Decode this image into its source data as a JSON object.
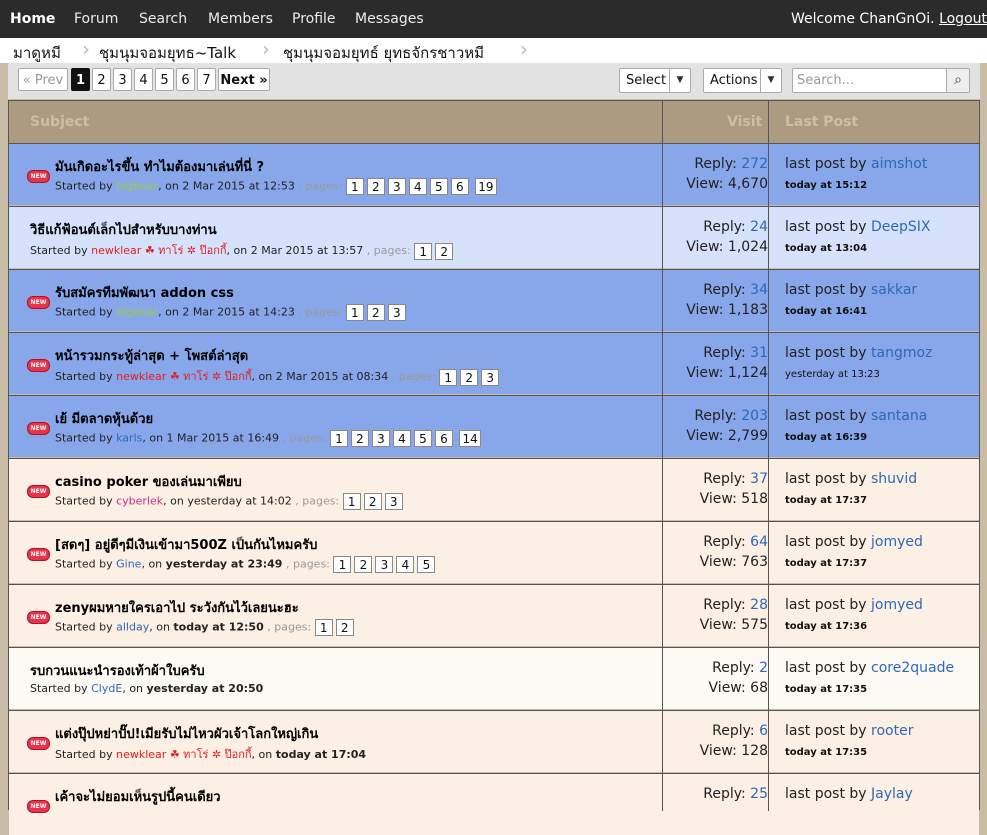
{
  "nav": {
    "items": [
      "Home",
      "Forum",
      "Search",
      "Members",
      "Profile",
      "Messages"
    ],
    "welcome": "Welcome ChanGnOi.",
    "logout": "Logout"
  },
  "breadcrumb": [
    "มาดูหมี",
    "ชุมนุมจอมยุทธ~Talk",
    "ชุมนุมจอมยุทธ์ ยุทธจักรชาวหมี"
  ],
  "pagination": {
    "prev": "« Prev",
    "pages": [
      "1",
      "2",
      "3",
      "4",
      "5",
      "6",
      "7"
    ],
    "current": "1",
    "next": "Next »"
  },
  "controls": {
    "select_label": "Select",
    "actions_label": "Actions",
    "search_placeholder": "Search..."
  },
  "table": {
    "headers": {
      "subject": "Subject",
      "visit": "Visit",
      "last_post": "Last Post"
    },
    "reply_label": "Reply:",
    "view_label": "View:",
    "last_post_by_label": "last post by",
    "started_by_label": "Started by",
    "pages_label": "pages:",
    "rows": [
      {
        "title": "มันเกิดอะไรขึ้น ทำไมต้องมาเล่นที่นี่ ?",
        "author": "bigbear",
        "date": "on 2 Mar 2015 at 12:53",
        "pages": [
          "1",
          "2",
          "3",
          "4",
          "5",
          "6",
          "19"
        ],
        "replies": "272",
        "views": "4,670",
        "last_user": "aimshot",
        "last_time": "today at 15:12"
      },
      {
        "title": "วิธีแก้ฟ้อนต์เล็กไปสำหรับบางท่าน",
        "author": "newklear ☘ ทาโร่ ✲ ป๊อกกี้",
        "date": "on 2 Mar 2015 at 13:57",
        "pages": [
          "1",
          "2"
        ],
        "replies": "24",
        "views": "1,024",
        "last_user": "DeepSIX",
        "last_time": "today at 13:04"
      },
      {
        "title": "รับสมัครทีมพัฒนา addon css",
        "author": "bigbear",
        "date": "on 2 Mar 2015 at 14:23",
        "pages": [
          "1",
          "2",
          "3"
        ],
        "replies": "34",
        "views": "1,183",
        "last_user": "sakkar",
        "last_time": "today at 16:41"
      },
      {
        "title": "หน้ารวมกระทู้ล่าสุด + โพสต์ล่าสุด",
        "author": "newklear ☘ ทาโร่ ✲ ป๊อกกี้",
        "date": "on 2 Mar 2015 at 08:34",
        "pages": [
          "1",
          "2",
          "3"
        ],
        "replies": "31",
        "views": "1,124",
        "last_user": "tangmoz",
        "last_time": "yesterday at 13:23"
      },
      {
        "title": "เย้ มีตลาดหุ้นด้วย",
        "author": "karls",
        "date": "on 1 Mar 2015 at 16:49",
        "pages": [
          "1",
          "2",
          "3",
          "4",
          "5",
          "6",
          "14"
        ],
        "replies": "203",
        "views": "2,799",
        "last_user": "santana",
        "last_time": "today at 16:39"
      },
      {
        "title": "casino poker ของเล่นมาเพียบ",
        "author": "cyberlek",
        "date": "on yesterday at 14:02",
        "pages": [
          "1",
          "2",
          "3"
        ],
        "replies": "37",
        "views": "518",
        "last_user": "shuvid",
        "last_time": "today at 17:37"
      },
      {
        "title": "[สดๆ] อยู่ดีๆมีเงินเข้ามา500Z เป็นกันไหมครับ",
        "author": "Gine",
        "date_prefix": "on",
        "date": "yesterday at 23:49",
        "pages": [
          "1",
          "2",
          "3",
          "4",
          "5"
        ],
        "replies": "64",
        "views": "763",
        "last_user": "jomyed",
        "last_time": "today at 17:37"
      },
      {
        "title": "zenyผมหายใครเอาไป ระวังกันไว้เลยนะฮะ",
        "author": "allday",
        "date_prefix": "on",
        "date": "today at 12:50",
        "pages": [
          "1",
          "2"
        ],
        "replies": "28",
        "views": "575",
        "last_user": "jomyed",
        "last_time": "today at 17:36"
      },
      {
        "title": "รบกวนแนะนำรองเท้าผ้าใบครับ",
        "author": "ClydE",
        "date_prefix": "on",
        "date": "yesterday at 20:50",
        "pages": [],
        "replies": "2",
        "views": "68",
        "last_user": "core2quade",
        "last_time": "today at 17:35"
      },
      {
        "title": "แต่งปุ๊ปหย่าปั๊ป!เมียรับไม่ไหวผัวเจ้าโลกใหญ่เกิน",
        "author": "newklear ☘ ทาโร่ ✲ ป๊อกกี้",
        "date_prefix": "on",
        "date": "today at 17:04",
        "pages": [],
        "replies": "6",
        "views": "128",
        "last_user": "rooter",
        "last_time": "today at 17:35"
      },
      {
        "title": "เค้าจะไม่ยอมเห็นรูปนี้คนเดียว",
        "replies": "25",
        "last_user": "Jaylay"
      }
    ]
  },
  "new_badge": "NEW"
}
